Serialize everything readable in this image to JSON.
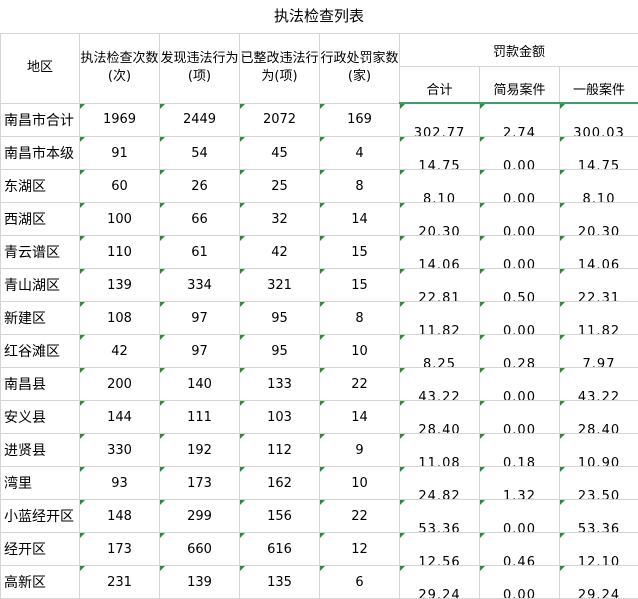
{
  "title": "执法检查列表",
  "headers": {
    "region": "地区",
    "inspections": "执法检查次数(次)",
    "violations": "发现违法行为(项)",
    "rectified": "已整改违法行为(项)",
    "penalized": "行政处罚家数(家)",
    "fines": "罚款金额",
    "fines_total": "合计",
    "fines_simple": "简易案件",
    "fines_general": "一般案件"
  },
  "rows": [
    {
      "region": "南昌市合计",
      "inspections": "1969",
      "violations": "2449",
      "rectified": "2072",
      "penalized": "169",
      "total": "302.77",
      "simple": "2.74",
      "general": "300.03"
    },
    {
      "region": "南昌市本级",
      "inspections": "91",
      "violations": "54",
      "rectified": "45",
      "penalized": "4",
      "total": "14.75",
      "simple": "0.00",
      "general": "14.75"
    },
    {
      "region": "东湖区",
      "inspections": "60",
      "violations": "26",
      "rectified": "25",
      "penalized": "8",
      "total": "8.10",
      "simple": "0.00",
      "general": "8.10"
    },
    {
      "region": "西湖区",
      "inspections": "100",
      "violations": "66",
      "rectified": "32",
      "penalized": "14",
      "total": "20.30",
      "simple": "0.00",
      "general": "20.30"
    },
    {
      "region": "青云谱区",
      "inspections": "110",
      "violations": "61",
      "rectified": "42",
      "penalized": "15",
      "total": "14.06",
      "simple": "0.00",
      "general": "14.06"
    },
    {
      "region": "青山湖区",
      "inspections": "139",
      "violations": "334",
      "rectified": "321",
      "penalized": "15",
      "total": "22.81",
      "simple": "0.50",
      "general": "22.31"
    },
    {
      "region": "新建区",
      "inspections": "108",
      "violations": "97",
      "rectified": "95",
      "penalized": "8",
      "total": "11.82",
      "simple": "0.00",
      "general": "11.82"
    },
    {
      "region": "红谷滩区",
      "inspections": "42",
      "violations": "97",
      "rectified": "95",
      "penalized": "10",
      "total": "8.25",
      "simple": "0.28",
      "general": "7.97"
    },
    {
      "region": "南昌县",
      "inspections": "200",
      "violations": "140",
      "rectified": "133",
      "penalized": "22",
      "total": "43.22",
      "simple": "0.00",
      "general": "43.22"
    },
    {
      "region": "安义县",
      "inspections": "144",
      "violations": "111",
      "rectified": "103",
      "penalized": "14",
      "total": "28.40",
      "simple": "0.00",
      "general": "28.40"
    },
    {
      "region": "进贤县",
      "inspections": "330",
      "violations": "192",
      "rectified": "112",
      "penalized": "9",
      "total": "11.08",
      "simple": "0.18",
      "general": "10.90"
    },
    {
      "region": "湾里",
      "inspections": "93",
      "violations": "173",
      "rectified": "162",
      "penalized": "10",
      "total": "24.82",
      "simple": "1.32",
      "general": "23.50"
    },
    {
      "region": "小蓝经开区",
      "inspections": "148",
      "violations": "299",
      "rectified": "156",
      "penalized": "22",
      "total": "53.36",
      "simple": "0.00",
      "general": "53.36"
    },
    {
      "region": "经开区",
      "inspections": "173",
      "violations": "660",
      "rectified": "616",
      "penalized": "12",
      "total": "12.56",
      "simple": "0.46",
      "general": "12.10"
    },
    {
      "region": "高新区",
      "inspections": "231",
      "violations": "139",
      "rectified": "135",
      "penalized": "6",
      "total": "29.24",
      "simple": "0.00",
      "general": "29.24"
    }
  ]
}
